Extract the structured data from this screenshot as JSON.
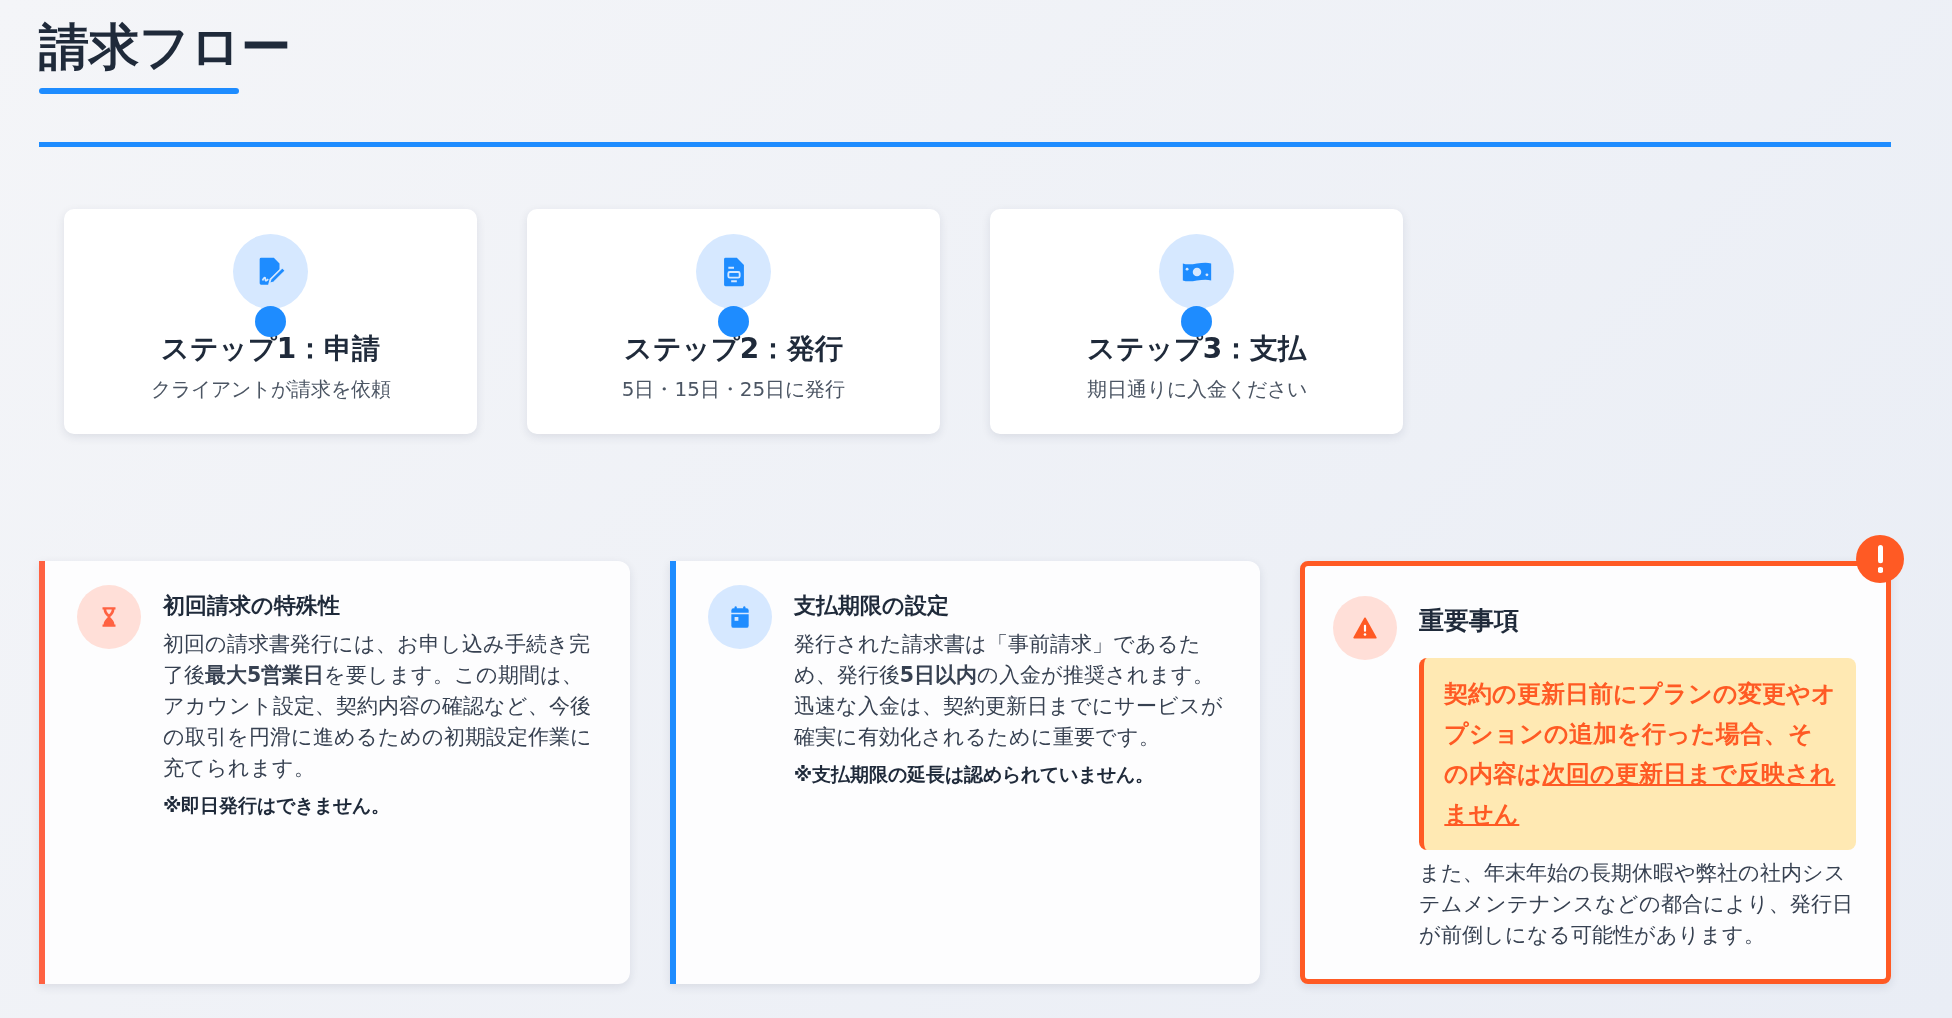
{
  "page_title": "請求フロー",
  "steps": [
    {
      "title": "ステップ1：申請",
      "description": "クライアントが請求を依頼"
    },
    {
      "title": "ステップ2：発行",
      "description": "5日・15日・25日に発行"
    },
    {
      "title": "ステップ3：支払",
      "description": "期日通りに入金ください"
    }
  ],
  "notes": [
    {
      "kind": "warning",
      "heading": "初回請求の特殊性",
      "body": "初回の請求書発行には、お申し込み手続き完了後**最大5営業日**を要します。この期間は、アカウント設定、契約内容の確認など、今後の取引を円滑に進めるための初期設定作業に充てられます。",
      "footnote": "※即日発行はできません。"
    },
    {
      "kind": "info",
      "heading": "支払期限の設定",
      "body": "発行された請求書は「事前請求」であるため、発行後**5日以内**の入金が推奨されます。迅速な入金は、契約更新日までにサービスが確実に有効化されるために重要です。",
      "footnote": "※支払期限の延長は認められていません。"
    },
    {
      "kind": "important",
      "heading": "重要事項",
      "highlight": "契約の更新日前にプランの変更やオプションの追加を行った場合、その内容は",
      "highlight_emphasis": "次回の更新日まで反映されません",
      "body": "また、年末年始の長期休暇や弊社の社内システムメンテナンスなどの都合により、発行日が前倒しになる可能性があります。"
    }
  ]
}
